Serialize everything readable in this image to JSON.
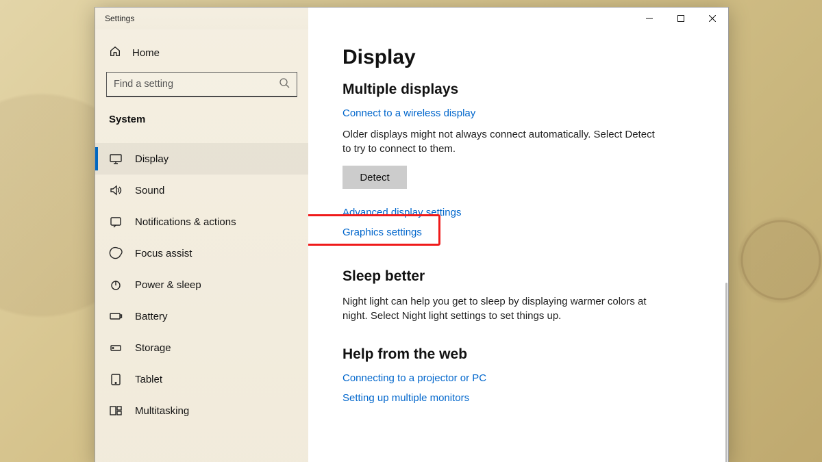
{
  "window": {
    "title": "Settings"
  },
  "sidebar": {
    "home_label": "Home",
    "search_placeholder": "Find a setting",
    "section_label": "System",
    "items": [
      {
        "label": "Display"
      },
      {
        "label": "Sound"
      },
      {
        "label": "Notifications & actions"
      },
      {
        "label": "Focus assist"
      },
      {
        "label": "Power & sleep"
      },
      {
        "label": "Battery"
      },
      {
        "label": "Storage"
      },
      {
        "label": "Tablet"
      },
      {
        "label": "Multitasking"
      }
    ]
  },
  "main": {
    "page_title": "Display",
    "multiple_displays": {
      "heading": "Multiple displays",
      "wireless_link": "Connect to a wireless display",
      "older_text": "Older displays might not always connect automatically. Select Detect to try to connect to them.",
      "detect_button": "Detect",
      "advanced_link": "Advanced display settings",
      "graphics_link": "Graphics settings"
    },
    "sleep_better": {
      "heading": "Sleep better",
      "text": "Night light can help you get to sleep by displaying warmer colors at night. Select Night light settings to set things up."
    },
    "help": {
      "heading": "Help from the web",
      "links": [
        "Connecting to a projector or PC",
        "Setting up multiple monitors"
      ]
    }
  }
}
